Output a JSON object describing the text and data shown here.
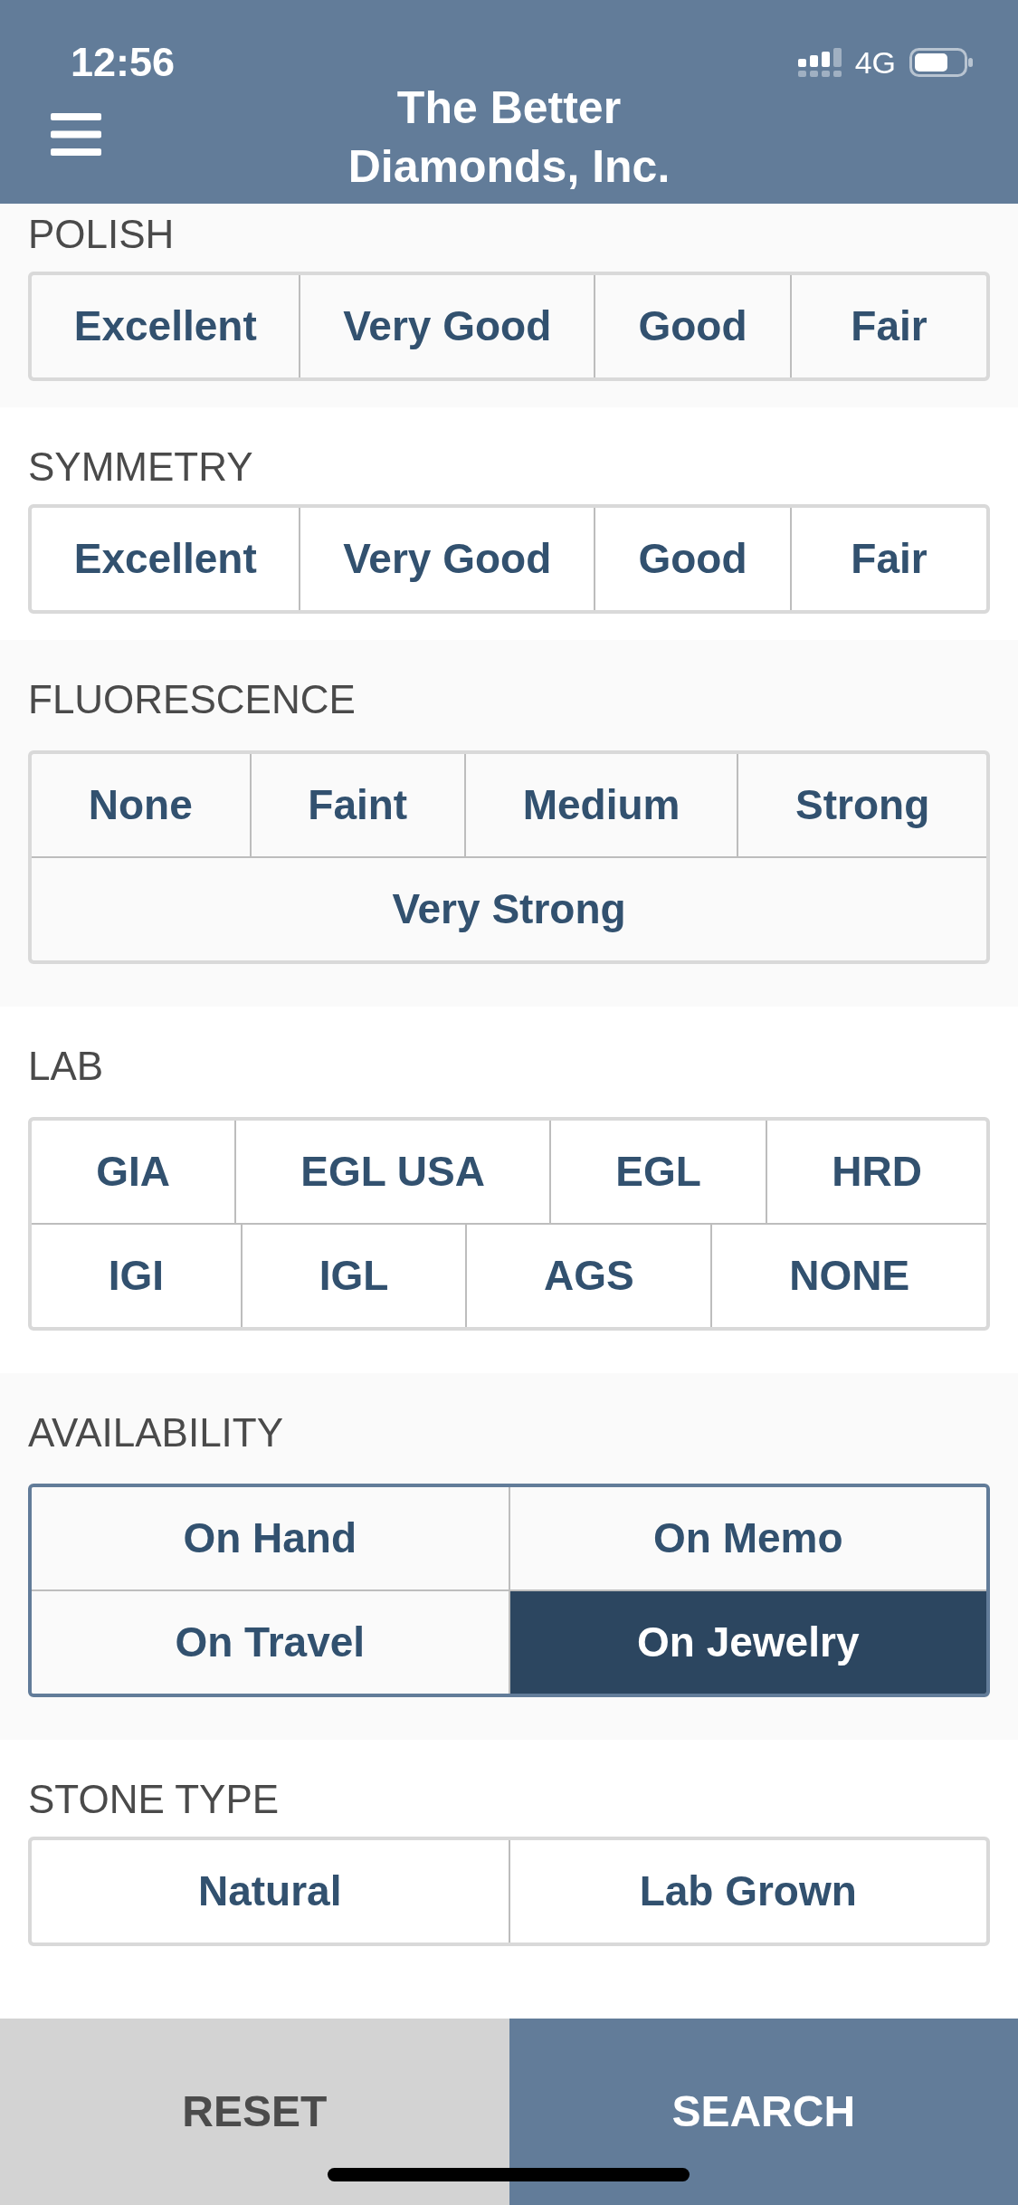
{
  "status_bar": {
    "time": "12:56",
    "network": "4G"
  },
  "header": {
    "title": "The Better Diamonds, Inc."
  },
  "sections": [
    {
      "label": "POLISH",
      "kind": "flow",
      "options": [
        {
          "label": "Excellent",
          "selected": false
        },
        {
          "label": "Very Good",
          "selected": false
        },
        {
          "label": "Good",
          "selected": false
        },
        {
          "label": "Fair",
          "selected": false
        }
      ]
    },
    {
      "label": "SYMMETRY",
      "kind": "flow",
      "options": [
        {
          "label": "Excellent",
          "selected": false
        },
        {
          "label": "Very Good",
          "selected": false
        },
        {
          "label": "Good",
          "selected": false
        },
        {
          "label": "Fair",
          "selected": false
        }
      ]
    },
    {
      "label": "FLUORESCENCE",
      "kind": "flow",
      "options": [
        {
          "label": "None",
          "selected": false
        },
        {
          "label": "Faint",
          "selected": false
        },
        {
          "label": "Medium",
          "selected": false
        },
        {
          "label": "Strong",
          "selected": false
        },
        {
          "label": "Very Strong",
          "selected": false
        }
      ]
    },
    {
      "label": "LAB",
      "kind": "flow",
      "options": [
        {
          "label": "GIA",
          "selected": false
        },
        {
          "label": "EGL USA",
          "selected": false
        },
        {
          "label": "EGL",
          "selected": false
        },
        {
          "label": "HRD",
          "selected": false
        },
        {
          "label": "IGI",
          "selected": false
        },
        {
          "label": "IGL",
          "selected": false
        },
        {
          "label": "AGS",
          "selected": false
        },
        {
          "label": "NONE",
          "selected": false
        }
      ]
    },
    {
      "label": "AVAILABILITY",
      "kind": "pairs",
      "options": [
        {
          "label": "On Hand",
          "selected": false
        },
        {
          "label": "On Memo",
          "selected": false
        },
        {
          "label": "On Travel",
          "selected": false
        },
        {
          "label": "On Jewelry",
          "selected": true
        }
      ]
    },
    {
      "label": "STONE TYPE",
      "kind": "pairs",
      "options": [
        {
          "label": "Natural",
          "selected": false
        },
        {
          "label": "Lab Grown",
          "selected": false
        }
      ]
    }
  ],
  "footer": {
    "buttons": [
      {
        "label": "RESET",
        "kind": "secondary"
      },
      {
        "label": "SEARCH",
        "kind": "primary"
      }
    ]
  }
}
